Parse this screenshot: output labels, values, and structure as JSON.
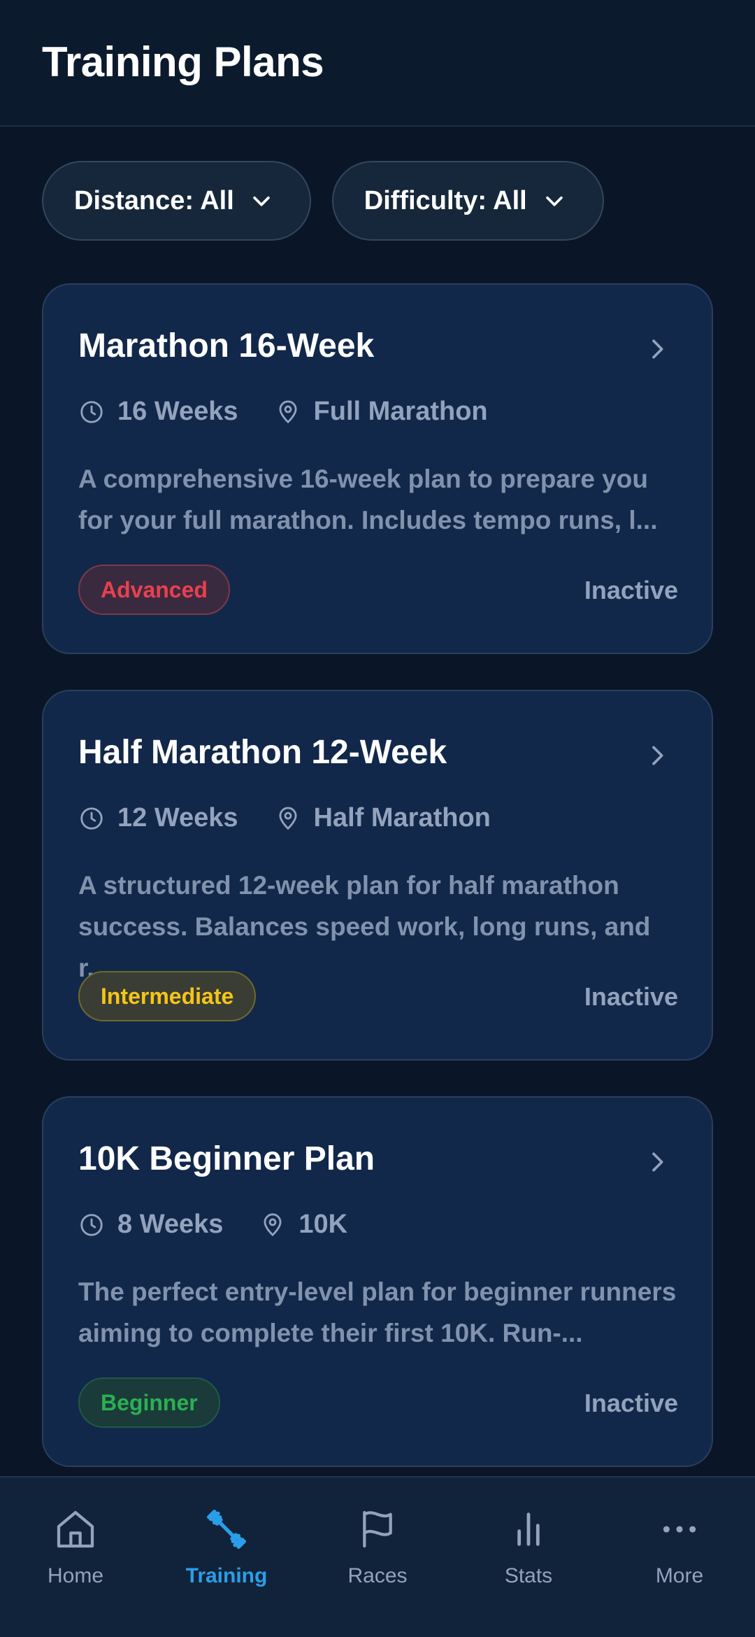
{
  "header": {
    "title": "Training Plans"
  },
  "filters": [
    {
      "label": "Distance: All",
      "icon": "chevron-down-icon"
    },
    {
      "label": "Difficulty: All",
      "icon": "chevron-down-icon"
    }
  ],
  "plans": [
    {
      "title": "Marathon 16-Week",
      "duration": "16 Weeks",
      "distance": "Full Marathon",
      "description": "A comprehensive 16-week plan to prepare you for your full marathon. Includes tempo runs, l...",
      "level": "Advanced",
      "status": "Inactive"
    },
    {
      "title": "Half Marathon 12-Week",
      "duration": "12 Weeks",
      "distance": "Half Marathon",
      "description": "A structured 12-week plan for half marathon success. Balances speed work, long runs, and r...",
      "level": "Intermediate",
      "status": "Inactive"
    },
    {
      "title": "10K Beginner Plan",
      "duration": "8 Weeks",
      "distance": "10K",
      "description": "The perfect entry-level plan for beginner runners aiming to complete their first 10K. Run-...",
      "level": "Beginner",
      "status": "Inactive"
    }
  ],
  "tabbar": {
    "active": "Training",
    "items": [
      {
        "label": "Home",
        "icon": "home-icon"
      },
      {
        "label": "Training",
        "icon": "dumbbell-icon"
      },
      {
        "label": "Races",
        "icon": "flag-icon"
      },
      {
        "label": "Stats",
        "icon": "bar-chart-icon"
      },
      {
        "label": "More",
        "icon": "more-dots-icon"
      }
    ]
  },
  "colors": {
    "background": "#0a1628",
    "card": "#12284a",
    "accent": "#2a9ee8",
    "advanced": "#e8404f",
    "intermediate": "#f5c518",
    "beginner": "#2ab052"
  }
}
